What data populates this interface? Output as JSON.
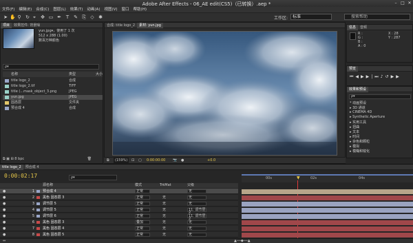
{
  "window": {
    "title": "Adobe After Effects - 06_AE edit(CS5)（已转换）.aep *"
  },
  "menu": [
    "文件(F)",
    "编辑(E)",
    "合成(C)",
    "图层(L)",
    "效果(T)",
    "动画(A)",
    "视图(V)",
    "窗口",
    "帮助(H)"
  ],
  "toolbar": {
    "workspace_label": "工作区:",
    "workspace_value": "标准",
    "search_placeholder": "搜索帮助"
  },
  "project": {
    "tabs": [
      "项目",
      "效果控件: 背景噪"
    ],
    "selected_name": "yun.jpg▾，使用了 1 次",
    "selected_dims": "512 x 288 (1.00)",
    "selected_color": "数百万种颜色",
    "search_placeholder": "ρ▾",
    "columns": {
      "name": "名称",
      "type": "类型",
      "size": "大小"
    },
    "items": [
      {
        "name": "title logo_2",
        "type": "合成",
        "color": "#9aa7c9"
      },
      {
        "name": "title logo_2.tif",
        "type": "TIFF",
        "color": "#9ad1c7"
      },
      {
        "name": "title (...mask_object_3.png",
        "type": "JPEG",
        "color": "#9ad1c7"
      },
      {
        "name": "yun.jpg",
        "type": "JPEG",
        "color": "#9ad1c7",
        "selected": true
      },
      {
        "name": "固态层",
        "type": "文件夹",
        "color": "#e2c66a"
      },
      {
        "name": "预合成 4",
        "type": "合成",
        "color": "#9aa7c9"
      }
    ],
    "footer_bpc": "8 bpc"
  },
  "viewer": {
    "tabs": [
      "合成: title logo_2",
      "素材: yun.jpg"
    ],
    "zoom": "(159%)",
    "time": "0:00:00:00",
    "plus": "+0.0"
  },
  "info": {
    "tabs": [
      "信息",
      "音频"
    ],
    "r_label": "R :",
    "g_label": "G :",
    "b_label": "B :",
    "a_label": "A : 0",
    "x_label": "X : 28",
    "y_label": "Y : 287"
  },
  "preview": {
    "tab": "预览"
  },
  "effects": {
    "tab": "效果和预设",
    "search_placeholder": "ρ▾",
    "items": [
      "* 动画预设",
      "▸ 3D 通道",
      "▸ CINEMA 4D",
      "▸ Synthetic Aperture",
      "▸ 实用工具",
      "▸ 扭曲",
      "▸ 文本",
      "▸ 时间",
      "▸ 杂色和颗粒",
      "▸ 模拟",
      "▸ 模糊和锐化"
    ]
  },
  "timeline": {
    "tabs": [
      "title logo_2",
      "预合成 4"
    ],
    "current_time": "0:00:02:17",
    "columns": {
      "source": "源名称",
      "mode": "模式",
      "trkmat": "TrkMat",
      "parent": "父级"
    },
    "layers": [
      {
        "num": "1",
        "name": "预合成 4",
        "mode": "正常",
        "trk": "",
        "parent": "无",
        "color": "#9aa7c9",
        "selected": true,
        "bar": "#b7a58a"
      },
      {
        "num": "2",
        "name": "黑色 固态层 3",
        "mode": "正常",
        "trk": "无",
        "parent": "无",
        "color": "#c84a4a",
        "bar": "#a0474a"
      },
      {
        "num": "3",
        "name": "调节层 5",
        "mode": "正常",
        "trk": "无",
        "parent": "无",
        "color": "#9aa7c9",
        "bar": "#9aa3c0"
      },
      {
        "num": "4",
        "name": "调节层 5",
        "mode": "正常",
        "trk": "无",
        "parent": "11. 调节层 2",
        "color": "#9aa7c9",
        "bar": "#9aa3c0"
      },
      {
        "num": "5",
        "name": "调节层 6",
        "mode": "正常",
        "trk": "无",
        "parent": "11. 调节层 2",
        "color": "#9aa7c9",
        "bar": "#9aa3c0"
      },
      {
        "num": "6",
        "name": "黑色 固态层 3",
        "mode": "叠加",
        "trk": "无",
        "parent": "无",
        "color": "#c84a4a",
        "bar": "#a0474a"
      },
      {
        "num": "7",
        "name": "黑色 固态层 4",
        "mode": "正常",
        "trk": "无",
        "parent": "无",
        "color": "#c84a4a",
        "bar": "#a0474a"
      },
      {
        "num": "8",
        "name": "黑色 固态层 5",
        "mode": "正常",
        "trk": "无",
        "parent": "无",
        "color": "#c84a4a",
        "bar": "#a0474a"
      }
    ],
    "ruler": [
      "00s",
      "02s",
      "04s"
    ]
  }
}
